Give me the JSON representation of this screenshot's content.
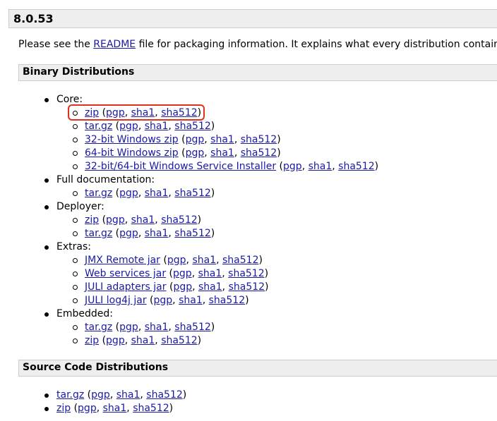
{
  "version": "8.0.53",
  "intro": {
    "before": "Please see the ",
    "link": "README",
    "after": " file for packaging information. It explains what every distribution contains."
  },
  "sections": {
    "binary": "Binary Distributions",
    "source": "Source Code Distributions"
  },
  "binary": {
    "core": {
      "label": "Core:",
      "items": [
        {
          "name": "zip",
          "pgp": "pgp",
          "sha1": "sha1",
          "sha512": "sha512"
        },
        {
          "name": "tar.gz",
          "pgp": "pgp",
          "sha1": "sha1",
          "sha512": "sha512"
        },
        {
          "name": "32-bit Windows zip",
          "pgp": "pgp",
          "sha1": "sha1",
          "sha512": "sha512"
        },
        {
          "name": "64-bit Windows zip",
          "pgp": "pgp",
          "sha1": "sha1",
          "sha512": "sha512"
        },
        {
          "name": "32-bit/64-bit Windows Service Installer",
          "pgp": "pgp",
          "sha1": "sha1",
          "sha512": "sha512"
        }
      ]
    },
    "fulldoc": {
      "label": "Full documentation:",
      "items": [
        {
          "name": "tar.gz",
          "pgp": "pgp",
          "sha1": "sha1",
          "sha512": "sha512"
        }
      ]
    },
    "deployer": {
      "label": "Deployer:",
      "items": [
        {
          "name": "zip",
          "pgp": "pgp",
          "sha1": "sha1",
          "sha512": "sha512"
        },
        {
          "name": "tar.gz",
          "pgp": "pgp",
          "sha1": "sha1",
          "sha512": "sha512"
        }
      ]
    },
    "extras": {
      "label": "Extras:",
      "items": [
        {
          "name": "JMX Remote jar",
          "pgp": "pgp",
          "sha1": "sha1",
          "sha512": "sha512"
        },
        {
          "name": "Web services jar",
          "pgp": "pgp",
          "sha1": "sha1",
          "sha512": "sha512"
        },
        {
          "name": "JULI adapters jar",
          "pgp": "pgp",
          "sha1": "sha1",
          "sha512": "sha512"
        },
        {
          "name": "JULI log4j jar",
          "pgp": "pgp",
          "sha1": "sha1",
          "sha512": "sha512"
        }
      ]
    },
    "embedded": {
      "label": "Embedded:",
      "items": [
        {
          "name": "tar.gz",
          "pgp": "pgp",
          "sha1": "sha1",
          "sha512": "sha512"
        },
        {
          "name": "zip",
          "pgp": "pgp",
          "sha1": "sha1",
          "sha512": "sha512"
        }
      ]
    }
  },
  "source": {
    "items": [
      {
        "name": "tar.gz",
        "pgp": "pgp",
        "sha1": "sha1",
        "sha512": "sha512"
      },
      {
        "name": "zip",
        "pgp": "pgp",
        "sha1": "sha1",
        "sha512": "sha512"
      }
    ]
  },
  "colors": {
    "link": "#1a1aa6",
    "header_bg": "#eeeeee",
    "highlight": "#e0301e"
  }
}
